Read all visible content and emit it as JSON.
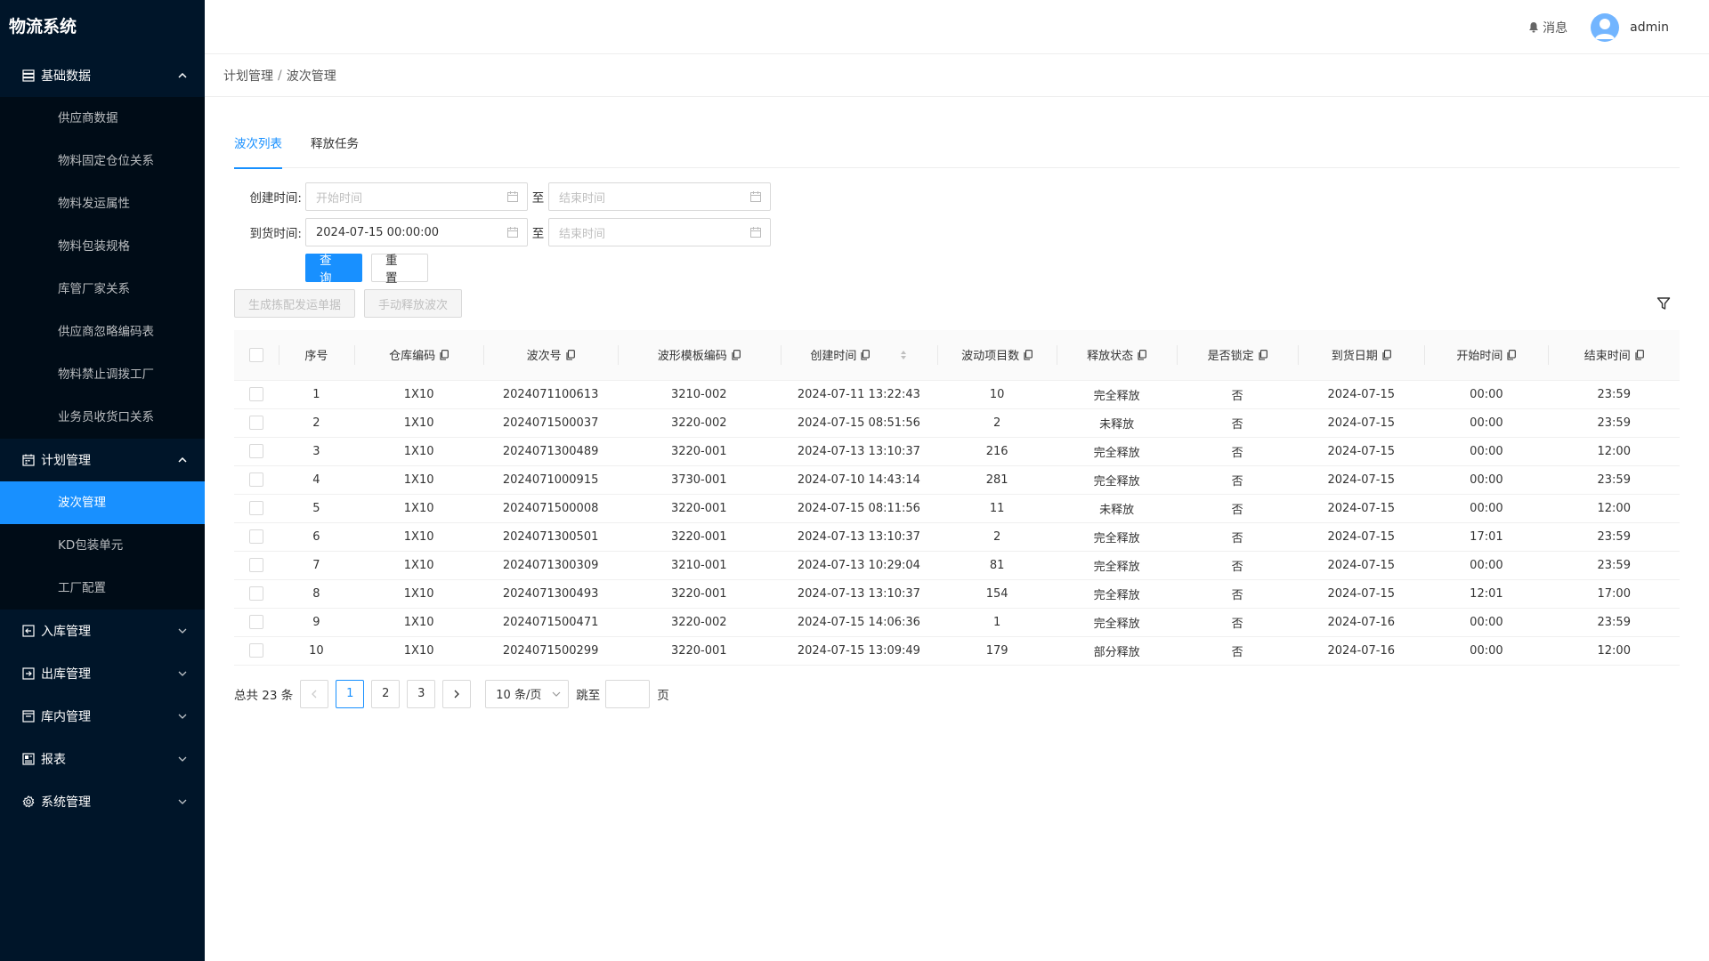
{
  "app": {
    "title": "物流系统"
  },
  "colors": {
    "sidebar_bg": "#001529",
    "submenu_bg": "#000c17",
    "accent": "#1890ff"
  },
  "sidebar": {
    "groups": [
      {
        "label": "基础数据",
        "icon": "database-icon",
        "expanded": true,
        "items": [
          "供应商数据",
          "物料固定仓位关系",
          "物料发运属性",
          "物料包装规格",
          "库管厂家关系",
          "供应商忽略编码表",
          "物料禁止调拨工厂",
          "业务员收货口关系"
        ]
      },
      {
        "label": "计划管理",
        "icon": "calendar-icon",
        "expanded": true,
        "items": [
          "波次管理",
          "KD包装单元",
          "工厂配置"
        ],
        "active_item": "波次管理"
      },
      {
        "label": "入库管理",
        "icon": "inbound-icon",
        "expanded": false
      },
      {
        "label": "出库管理",
        "icon": "outbound-icon",
        "expanded": false
      },
      {
        "label": "库内管理",
        "icon": "warehouse-icon",
        "expanded": false
      },
      {
        "label": "报表",
        "icon": "report-icon",
        "expanded": false
      },
      {
        "label": "系统管理",
        "icon": "gear-icon",
        "expanded": false
      }
    ]
  },
  "header": {
    "messages_label": "消息",
    "username": "admin"
  },
  "breadcrumb": {
    "parent": "计划管理",
    "separator": "/",
    "current": "波次管理"
  },
  "tabs": [
    {
      "label": "波次列表",
      "active": true
    },
    {
      "label": "释放任务",
      "active": false
    }
  ],
  "filters": {
    "created_label": "创建时间:",
    "arrival_label": "到货时间:",
    "to_label": "至",
    "start_placeholder": "开始时间",
    "end_placeholder": "结束时间",
    "arrival_start_value": "2024-07-15 00:00:00",
    "search_button": "查询",
    "reset_button": "重置"
  },
  "toolbar": {
    "generate_button": "生成拣配发运单据",
    "release_button": "手动释放波次"
  },
  "table": {
    "columns": [
      "序号",
      "仓库编码",
      "波次号",
      "波形模板编码",
      "创建时间",
      "波动项目数",
      "释放状态",
      "是否锁定",
      "到货日期",
      "开始时间",
      "结束时间"
    ],
    "rows": [
      [
        "1",
        "1X10",
        "2024071100613",
        "3210-002",
        "2024-07-11 13:22:43",
        "10",
        "完全释放",
        "否",
        "2024-07-15",
        "00:00",
        "23:59"
      ],
      [
        "2",
        "1X10",
        "2024071500037",
        "3220-002",
        "2024-07-15 08:51:56",
        "2",
        "未释放",
        "否",
        "2024-07-15",
        "00:00",
        "23:59"
      ],
      [
        "3",
        "1X10",
        "2024071300489",
        "3220-001",
        "2024-07-13 13:10:37",
        "216",
        "完全释放",
        "否",
        "2024-07-15",
        "00:00",
        "12:00"
      ],
      [
        "4",
        "1X10",
        "2024071000915",
        "3730-001",
        "2024-07-10 14:43:14",
        "281",
        "完全释放",
        "否",
        "2024-07-15",
        "00:00",
        "23:59"
      ],
      [
        "5",
        "1X10",
        "2024071500008",
        "3220-001",
        "2024-07-15 08:11:56",
        "11",
        "未释放",
        "否",
        "2024-07-15",
        "00:00",
        "12:00"
      ],
      [
        "6",
        "1X10",
        "2024071300501",
        "3220-001",
        "2024-07-13 13:10:37",
        "2",
        "完全释放",
        "否",
        "2024-07-15",
        "17:01",
        "23:59"
      ],
      [
        "7",
        "1X10",
        "2024071300309",
        "3210-001",
        "2024-07-13 10:29:04",
        "81",
        "完全释放",
        "否",
        "2024-07-15",
        "00:00",
        "23:59"
      ],
      [
        "8",
        "1X10",
        "2024071300493",
        "3220-001",
        "2024-07-13 13:10:37",
        "154",
        "完全释放",
        "否",
        "2024-07-15",
        "12:01",
        "17:00"
      ],
      [
        "9",
        "1X10",
        "2024071500471",
        "3220-002",
        "2024-07-15 14:06:36",
        "1",
        "完全释放",
        "否",
        "2024-07-16",
        "00:00",
        "23:59"
      ],
      [
        "10",
        "1X10",
        "2024071500299",
        "3220-001",
        "2024-07-15 13:09:49",
        "179",
        "部分释放",
        "否",
        "2024-07-16",
        "00:00",
        "12:00"
      ]
    ]
  },
  "pagination": {
    "total_text": "总共 23 条",
    "pages": [
      "1",
      "2",
      "3"
    ],
    "current_page": "1",
    "page_size": "10 条/页",
    "jump_label": "跳至",
    "page_suffix": "页"
  }
}
